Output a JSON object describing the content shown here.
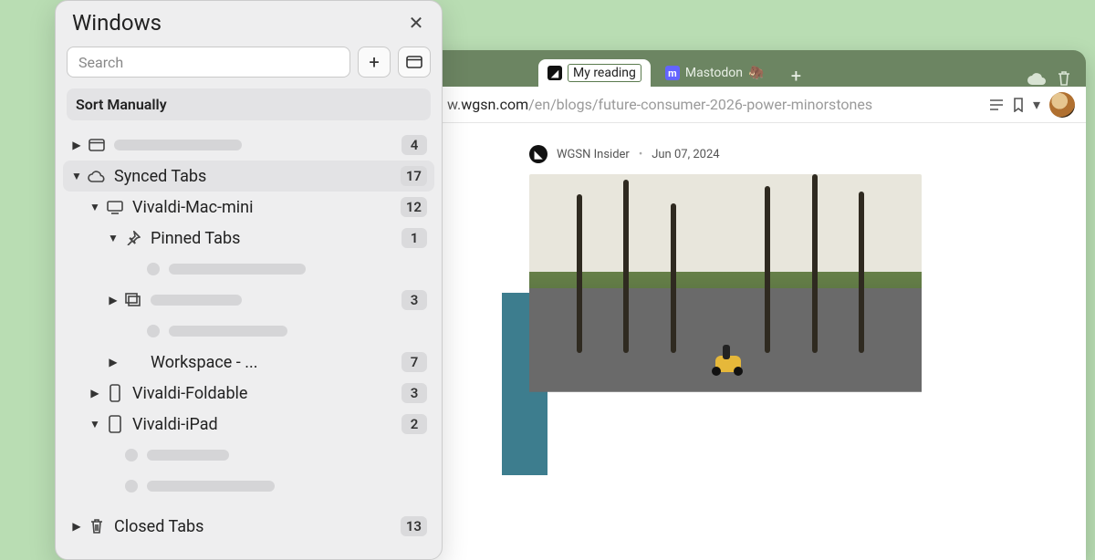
{
  "panel": {
    "title": "Windows",
    "search_placeholder": "Search",
    "sort_label": "Sort Manually",
    "root_window_count": "4",
    "synced": {
      "label": "Synced Tabs",
      "count": "17"
    },
    "devices": {
      "mac": {
        "label": "Vivaldi-Mac-mini",
        "count": "12"
      },
      "pinned": {
        "label": "Pinned Tabs",
        "count": "1"
      },
      "stack": {
        "count": "3"
      },
      "workspace": {
        "label": "Workspace - ...",
        "count": "7"
      },
      "foldable": {
        "label": "Vivaldi-Foldable",
        "count": "3"
      },
      "ipad": {
        "label": "Vivaldi-iPad",
        "count": "2"
      }
    },
    "closed": {
      "label": "Closed Tabs",
      "count": "13"
    }
  },
  "browser": {
    "tabs": {
      "active": {
        "label": "My reading"
      },
      "inactive": {
        "label": "Mastodon",
        "emoji": "🦣"
      }
    },
    "url": {
      "prefix": "w.",
      "domain": "wgsn.com",
      "path": "/en/blogs/future-consumer-2026-power-minorstones"
    },
    "article": {
      "source": "WGSN Insider",
      "date": "Jun 07, 2024"
    }
  }
}
